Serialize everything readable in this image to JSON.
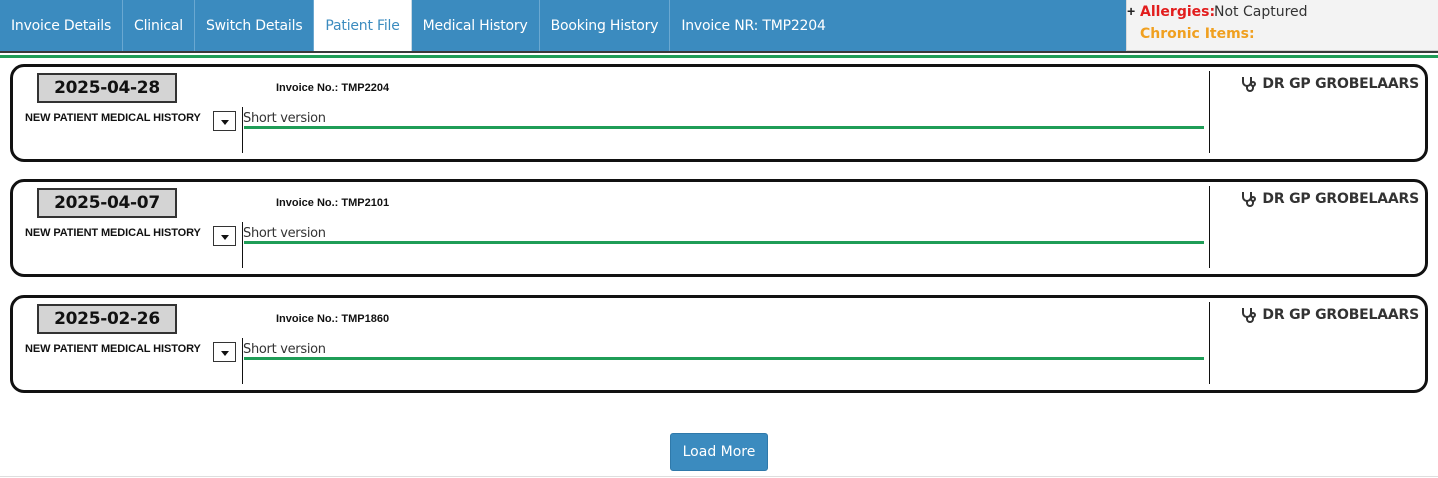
{
  "tabs": [
    {
      "label": "Invoice Details",
      "active": false
    },
    {
      "label": "Clinical",
      "active": false
    },
    {
      "label": "Switch Details",
      "active": false
    },
    {
      "label": "Patient File",
      "active": true
    },
    {
      "label": "Medical History",
      "active": false
    },
    {
      "label": "Booking History",
      "active": false
    }
  ],
  "invoice_nr_label": "Invoice NR: TMP2204",
  "alerts": {
    "plus": "+",
    "allergies_label": "Allergies:",
    "allergies_value": "Not Captured",
    "chronic_label": "Chronic Items:"
  },
  "records": [
    {
      "date": "2025-04-28",
      "invoice": "Invoice No.: TMP2204",
      "type": "NEW PATIENT MEDICAL HISTORY",
      "note_label": "Short version",
      "doctor": "DR GP GROBELAARS",
      "doctor_icon": "stethoscope-icon"
    },
    {
      "date": "2025-04-07",
      "invoice": "Invoice No.: TMP2101",
      "type": "NEW PATIENT MEDICAL HISTORY",
      "note_label": "Short version",
      "doctor": "DR GP GROBELAARS",
      "doctor_icon": "stethoscope-icon"
    },
    {
      "date": "2025-02-26",
      "invoice": "Invoice No.: TMP1860",
      "type": "NEW PATIENT MEDICAL HISTORY",
      "note_label": "Short version",
      "doctor": "DR GP GROBELAARS",
      "doctor_icon": "stethoscope-icon"
    }
  ],
  "load_more_label": "Load More",
  "colors": {
    "tab_bar": "#3b8bbf",
    "accent_green": "#1f9d57",
    "allergy_red": "#e21d1d",
    "chronic_orange": "#f0a020"
  }
}
